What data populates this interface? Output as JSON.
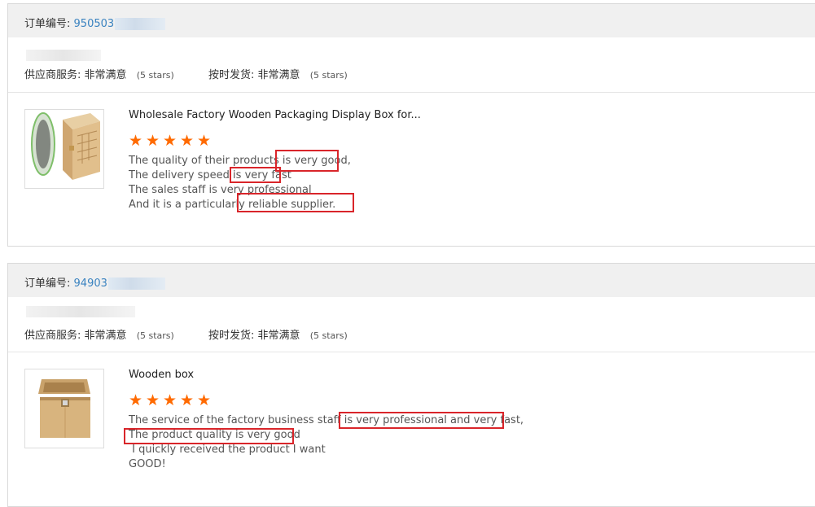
{
  "reviews": [
    {
      "order_label": "订单编号:",
      "order_number": "950503",
      "supplier_service_label": "供应商服务:",
      "supplier_service_value": "非常满意",
      "supplier_service_stars": "(5 stars)",
      "ontime_label": "按时发货:",
      "ontime_value": "非常满意",
      "ontime_stars": "(5 stars)",
      "product_title": "Wholesale Factory Wooden Packaging Display Box for...",
      "rating": 5,
      "review_lines": [
        "The quality of their products is very good,",
        "The delivery speed is very fast",
        "The sales staff is very professional",
        "And it is a particularly reliable supplier."
      ]
    },
    {
      "order_label": "订单编号:",
      "order_number": "94903",
      "supplier_service_label": "供应商服务:",
      "supplier_service_value": "非常满意",
      "supplier_service_stars": "(5 stars)",
      "ontime_label": "按时发货:",
      "ontime_value": "非常满意",
      "ontime_stars": "(5 stars)",
      "product_title": "Wooden box",
      "rating": 5,
      "review_lines": [
        "The service of the factory business staff is very professional and very fast,",
        "The product quality is very good",
        " I quickly received the product I want",
        "GOOD!"
      ]
    }
  ],
  "colors": {
    "star": "#ff6a00",
    "highlight": "#d9252a",
    "order_number": "#3b83c0",
    "header_bg": "#f0f0f0"
  }
}
